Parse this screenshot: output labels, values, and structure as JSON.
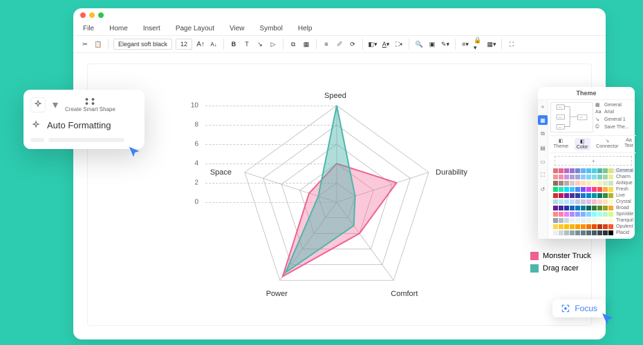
{
  "menu": {
    "items": [
      "File",
      "Home",
      "Insert",
      "Page Layout",
      "View",
      "Symbol",
      "Help"
    ]
  },
  "toolbar": {
    "font_name": "Elegant soft black",
    "font_size": "12"
  },
  "chart_data": {
    "type": "radar",
    "axes": [
      "Speed",
      "Durability",
      "Comfort",
      "Power",
      "Space"
    ],
    "ticks": [
      0,
      2,
      4,
      6,
      8,
      10
    ],
    "max": 10,
    "series": [
      {
        "name": "Monster Truck",
        "color": "#f06292",
        "fill": "rgba(240,98,146,0.35)",
        "values": [
          4,
          6.5,
          4,
          9.5,
          3
        ]
      },
      {
        "name": "Drag racer",
        "color": "#4db6ac",
        "fill": "rgba(77,182,172,0.45)",
        "values": [
          10,
          2,
          3,
          9,
          2
        ]
      }
    ]
  },
  "legend": [
    {
      "name": "Monster Truck",
      "color": "#f06292"
    },
    {
      "name": "Drag racer",
      "color": "#4db6ac"
    }
  ],
  "auto_format": {
    "create_label": "Create Smart Shape",
    "title": "Auto Formatting"
  },
  "theme_panel": {
    "title": "Theme",
    "options": [
      "General",
      "Arial",
      "General 1",
      "Save The..."
    ],
    "tabs": [
      "Theme",
      "Color",
      "Connector",
      "Text"
    ],
    "palettes": [
      "General",
      "Charm",
      "Antique",
      "Fresh",
      "Live",
      "Crystal",
      "Broad",
      "Sprinkle",
      "Tranquil",
      "Opulent",
      "Placid"
    ]
  },
  "focus": {
    "label": "Focus"
  },
  "palette_colors": [
    [
      "#e57373",
      "#f06292",
      "#ba68c8",
      "#9575cd",
      "#7986cb",
      "#64b5f6",
      "#4fc3f7",
      "#4dd0e1",
      "#4db6ac",
      "#81c784",
      "#dce775"
    ],
    [
      "#ef9a9a",
      "#f48fb1",
      "#ce93d8",
      "#b39ddb",
      "#9fa8da",
      "#90caf9",
      "#81d4fa",
      "#80deea",
      "#80cbc4",
      "#a5d6a7",
      "#e6ee9c"
    ],
    [
      "#8d6e63",
      "#a1887f",
      "#bcaaa4",
      "#d7ccc8",
      "#ffccbc",
      "#ffe0b2",
      "#ffecb3",
      "#fff9c4",
      "#f0f4c3",
      "#dcedc8",
      "#c8e6c9"
    ],
    [
      "#00e676",
      "#1de9b6",
      "#00e5ff",
      "#40c4ff",
      "#448aff",
      "#7c4dff",
      "#e040fb",
      "#ff4081",
      "#ff5252",
      "#ffab40",
      "#ffd740"
    ],
    [
      "#d32f2f",
      "#c2185b",
      "#7b1fa2",
      "#512da8",
      "#303f9f",
      "#1976d2",
      "#0288d1",
      "#0097a7",
      "#00796b",
      "#388e3c",
      "#afb42b"
    ],
    [
      "#b2dfdb",
      "#b2ebf2",
      "#b3e5fc",
      "#bbdefb",
      "#c5cae9",
      "#d1c4e9",
      "#e1bee7",
      "#f8bbd0",
      "#ffcdd2",
      "#ffe0b2",
      "#fff9c4"
    ],
    [
      "#6a1b9a",
      "#4527a0",
      "#283593",
      "#1565c0",
      "#0277bd",
      "#00838f",
      "#00695c",
      "#2e7d32",
      "#558b2f",
      "#9e9d24",
      "#f9a825"
    ],
    [
      "#ff8a80",
      "#ff80ab",
      "#ea80fc",
      "#b388ff",
      "#8c9eff",
      "#82b1ff",
      "#80d8ff",
      "#84ffff",
      "#a7ffeb",
      "#b9f6ca",
      "#ccff90"
    ],
    [
      "#90a4ae",
      "#b0bec5",
      "#cfd8dc",
      "#eceff1",
      "#e0f7fa",
      "#e0f2f1",
      "#e8f5e9",
      "#f1f8e9",
      "#f9fbe7",
      "#fffde7",
      "#fff8e1"
    ],
    [
      "#ffd54f",
      "#ffca28",
      "#ffc107",
      "#ffb300",
      "#ffa000",
      "#ff8f00",
      "#ff6f00",
      "#e65100",
      "#bf360c",
      "#d84315",
      "#ff5722"
    ],
    [
      "#eceff1",
      "#cfd8dc",
      "#b0bec5",
      "#90a4ae",
      "#78909c",
      "#607d8b",
      "#546e7a",
      "#455a64",
      "#37474f",
      "#263238",
      "#000000"
    ]
  ]
}
